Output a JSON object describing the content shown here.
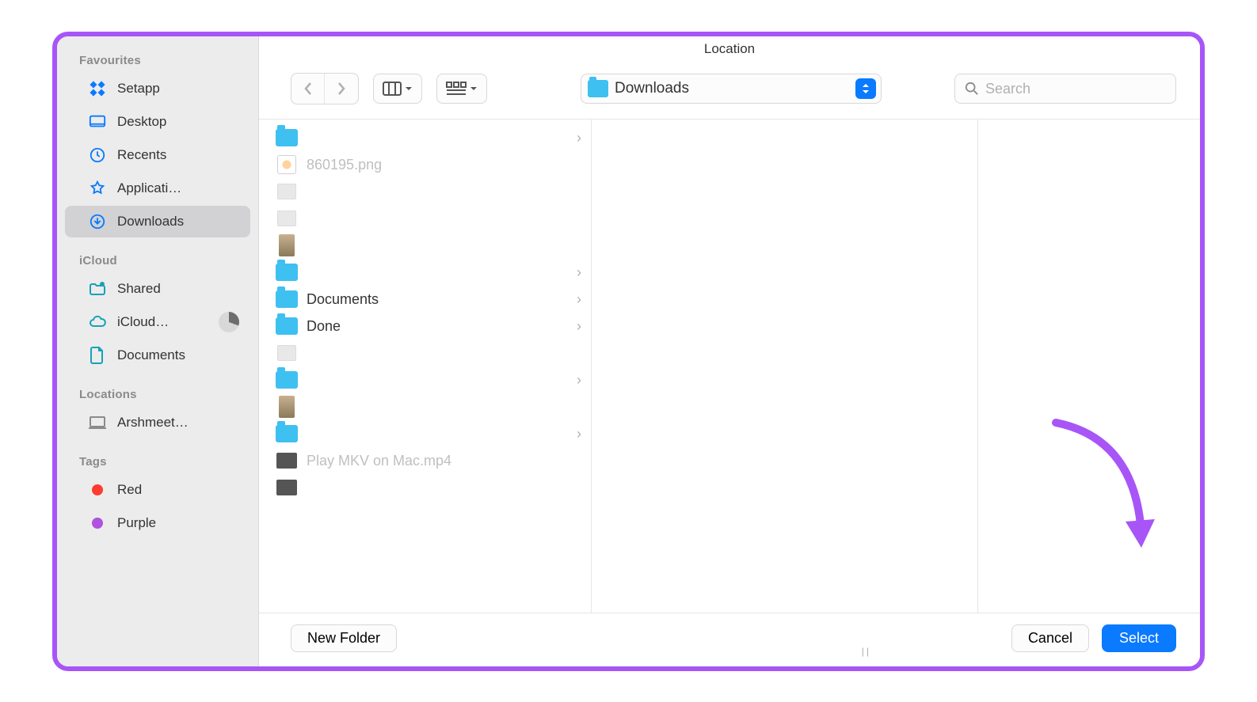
{
  "window": {
    "title": "Location"
  },
  "sidebar": {
    "sections": [
      {
        "header": "Favourites",
        "items": [
          {
            "label": "Setapp",
            "icon": "setapp"
          },
          {
            "label": "Desktop",
            "icon": "desktop"
          },
          {
            "label": "Recents",
            "icon": "recents"
          },
          {
            "label": "Applicati…",
            "icon": "applications"
          },
          {
            "label": "Downloads",
            "icon": "downloads",
            "selected": true
          }
        ]
      },
      {
        "header": "iCloud",
        "items": [
          {
            "label": "Shared",
            "icon": "shared"
          },
          {
            "label": "iCloud…",
            "icon": "icloud",
            "trailing": "pie"
          },
          {
            "label": "Documents",
            "icon": "documents"
          }
        ]
      },
      {
        "header": "Locations",
        "items": [
          {
            "label": "Arshmeet…",
            "icon": "laptop"
          }
        ]
      },
      {
        "header": "Tags",
        "items": [
          {
            "label": "Red",
            "icon": "tag",
            "color": "#ff3b30"
          },
          {
            "label": "Purple",
            "icon": "tag",
            "color": "#af52de"
          }
        ]
      }
    ]
  },
  "toolbar": {
    "path_label": "Downloads",
    "search_placeholder": "Search"
  },
  "files": [
    {
      "type": "folder",
      "name": "",
      "blurred": true,
      "chevron": true
    },
    {
      "type": "png",
      "name": "860195.png",
      "dim": true
    },
    {
      "type": "file",
      "name": "",
      "blurred": true
    },
    {
      "type": "file",
      "name": "",
      "blurred": true
    },
    {
      "type": "image",
      "name": "",
      "blurred": true
    },
    {
      "type": "folder",
      "name": "",
      "blurred": true,
      "chevron": true
    },
    {
      "type": "folder",
      "name": "Documents",
      "chevron": true
    },
    {
      "type": "folder",
      "name": "Done",
      "chevron": true
    },
    {
      "type": "file",
      "name": "",
      "blurred": true
    },
    {
      "type": "folder",
      "name": "",
      "blurred": true,
      "chevron": true
    },
    {
      "type": "image",
      "name": "",
      "blurred": true
    },
    {
      "type": "folder",
      "name": "",
      "blurred": true,
      "chevron": true
    },
    {
      "type": "video",
      "name": "Play MKV on Mac.mp4",
      "dim": true
    },
    {
      "type": "video",
      "name": "",
      "blurred": true,
      "dim": true
    }
  ],
  "footer": {
    "new_folder": "New Folder",
    "cancel": "Cancel",
    "select": "Select"
  },
  "colors": {
    "accent": "#0a7aff",
    "border": "#a855f7"
  }
}
